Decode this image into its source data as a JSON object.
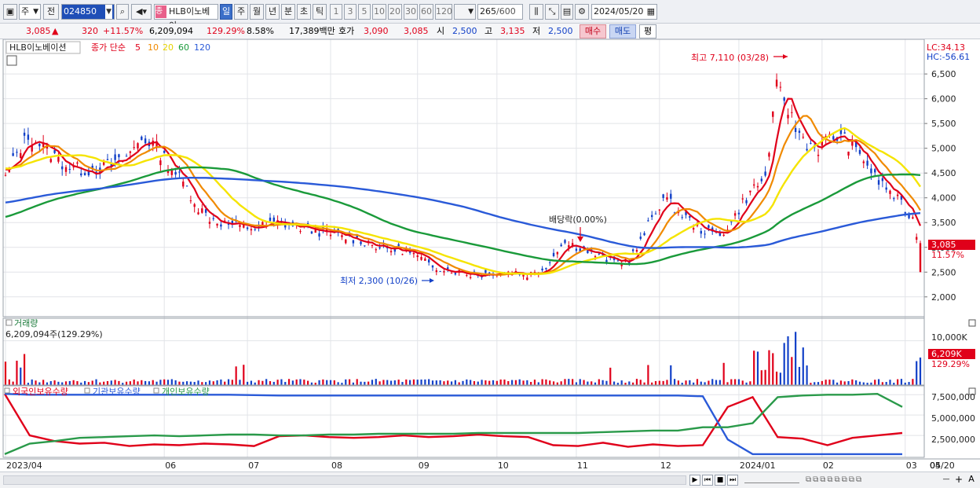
{
  "toolbar": {
    "period_type": "주",
    "prev_label": "전",
    "stock_code": "024850",
    "stock_tag": "종",
    "stock_name": "HLB이노베이",
    "intervals": [
      "일",
      "주",
      "월",
      "년",
      "분",
      "초",
      "틱"
    ],
    "active_interval": "일",
    "minute_options": [
      "1",
      "3",
      "5",
      "10",
      "20",
      "30",
      "60",
      "120"
    ],
    "count": "265",
    "count_total": "/600",
    "date": "2024/05/20"
  },
  "quote": {
    "price": "3,085",
    "change_arrow": "▲",
    "change": "320",
    "change_pct": "+11.57%",
    "volume": "6,209,094",
    "volume_ratio": "129.29%",
    "turnover_rate": "8.58%",
    "trade_value": "17,389백만",
    "ask_label": "호가",
    "ask1": "3,090",
    "ask2": "3,085",
    "open_label": "시",
    "open": "2,500",
    "high_label": "고",
    "high": "3,135",
    "low_label": "저",
    "low": "2,500",
    "buy_label": "매수",
    "sell_label": "매도",
    "flat_label": "평"
  },
  "colors": {
    "up": "#e0001a",
    "down": "#1240c8",
    "ma5": "#e0001a",
    "ma10": "#f08a00",
    "ma20": "#f5e400",
    "ma60": "#1a9a3a",
    "ma120": "#2a5ad8",
    "foreign": "#e0001a",
    "institution": "#2a5ad8",
    "individual": "#2a9a4a"
  },
  "chart_data": [
    {
      "type": "candlestick",
      "legend": {
        "title": "HLB이노베이션",
        "prefix": "종가 단순",
        "ma_periods": [
          "5",
          "10",
          "20",
          "60",
          "120"
        ]
      },
      "x_ticks": [
        "2023/04",
        "06",
        "07",
        "08",
        "09",
        "10",
        "11",
        "12",
        "2024/01",
        "02",
        "03",
        "04",
        "05",
        "05/20"
      ],
      "y_ticks": [
        "2,000",
        "2,500",
        "3,000",
        "3,500",
        "4,000",
        "4,500",
        "5,000",
        "5,500",
        "6,000",
        "6,500"
      ],
      "ylim": [
        1600,
        7200
      ],
      "lc": "LC:34.13",
      "hc": "HC:-56.61",
      "last_price_label": "3,085",
      "last_change_label": "11.57%",
      "annotations": {
        "high": "최고 7,110 (03/28)",
        "low": "최저 2,300 (10/26)",
        "dividend": "배당락(0.00%)"
      },
      "close_path": [
        [
          0,
          4400
        ],
        [
          3,
          4900
        ],
        [
          6,
          5250
        ],
        [
          9,
          5100
        ],
        [
          12,
          4900
        ],
        [
          15,
          4700
        ],
        [
          18,
          4600
        ],
        [
          21,
          4550
        ],
        [
          24,
          4600
        ],
        [
          27,
          4650
        ],
        [
          30,
          4700
        ],
        [
          33,
          4900
        ],
        [
          36,
          5200
        ],
        [
          39,
          5100
        ],
        [
          42,
          4800
        ],
        [
          45,
          4500
        ],
        [
          48,
          4200
        ],
        [
          51,
          3800
        ],
        [
          54,
          3600
        ],
        [
          57,
          3500
        ],
        [
          60,
          3450
        ],
        [
          63,
          3400
        ],
        [
          66,
          3400
        ],
        [
          69,
          3450
        ],
        [
          72,
          3500
        ],
        [
          75,
          3450
        ],
        [
          78,
          3400
        ],
        [
          81,
          3350
        ],
        [
          84,
          3300
        ],
        [
          87,
          3250
        ],
        [
          90,
          3200
        ],
        [
          93,
          3150
        ],
        [
          96,
          3100
        ],
        [
          99,
          3000
        ],
        [
          102,
          2950
        ],
        [
          105,
          2950
        ],
        [
          108,
          2850
        ],
        [
          111,
          2700
        ],
        [
          114,
          2600
        ],
        [
          117,
          2550
        ],
        [
          120,
          2500
        ],
        [
          123,
          2450
        ],
        [
          126,
          2450
        ],
        [
          129,
          2500
        ],
        [
          132,
          2500
        ],
        [
          135,
          2500
        ],
        [
          138,
          2450
        ],
        [
          141,
          2500
        ],
        [
          144,
          2700
        ],
        [
          147,
          3100
        ],
        [
          150,
          3050
        ],
        [
          153,
          2950
        ],
        [
          156,
          2850
        ],
        [
          159,
          2750
        ],
        [
          162,
          2700
        ],
        [
          165,
          2750
        ],
        [
          168,
          3100
        ],
        [
          171,
          3600
        ],
        [
          174,
          4000
        ],
        [
          177,
          3800
        ],
        [
          180,
          3600
        ],
        [
          183,
          3400
        ],
        [
          186,
          3300
        ],
        [
          189,
          3250
        ],
        [
          192,
          3500
        ],
        [
          195,
          3900
        ],
        [
          198,
          4200
        ],
        [
          201,
          4400
        ],
        [
          204,
          6200
        ],
        [
          206,
          6000
        ],
        [
          209,
          5400
        ],
        [
          212,
          5100
        ],
        [
          215,
          5000
        ],
        [
          218,
          5200
        ],
        [
          221,
          5250
        ],
        [
          224,
          5000
        ],
        [
          227,
          4800
        ],
        [
          230,
          4400
        ],
        [
          233,
          4200
        ],
        [
          236,
          3950
        ],
        [
          238,
          3750
        ],
        [
          240,
          3550
        ],
        [
          241,
          3300
        ],
        [
          242,
          3085
        ]
      ]
    },
    {
      "type": "bar",
      "legend": "거래량",
      "volume_label": "6,209,094주(129.29%)",
      "y_ticks": [
        "10,000K"
      ],
      "last_label": "6,209K",
      "last_pct": "129.29%",
      "unit": "K shares"
    },
    {
      "type": "line",
      "legend": [
        "외국인보유수량",
        "기관보유수량",
        "개인보유수량"
      ],
      "y_ticks": [
        "7,500,000",
        "5,000,000",
        "2,500,000"
      ],
      "series": [
        {
          "name": "외국인보유수량",
          "values": [
            7600000,
            2500000,
            1800000,
            1500000,
            1600000,
            1200000,
            1400000,
            1300000,
            1500000,
            1400000,
            1200000,
            2400000,
            2500000,
            2300000,
            2200000,
            2300000,
            2500000,
            2300000,
            2400000,
            2600000,
            2400000,
            2300000,
            1300000,
            1200000,
            1600000,
            1100000,
            1400000,
            1200000,
            1300000,
            6000000,
            7200000,
            2300000,
            2100000,
            1300000,
            2200000,
            2500000,
            2800000
          ]
        },
        {
          "name": "기관보유수량",
          "values": [
            7600000,
            7500000,
            7500000,
            7500000,
            7500000,
            7500000,
            7500000,
            7500000,
            7500000,
            7500000,
            7450000,
            7400000,
            7400000,
            7400000,
            7400000,
            7400000,
            7400000,
            7400000,
            7400000,
            7400000,
            7400000,
            7400000,
            7400000,
            7400000,
            7400000,
            7400000,
            7400000,
            7400000,
            7300000,
            2000000,
            200000,
            200000,
            200000,
            200000,
            200000,
            200000,
            200000
          ]
        },
        {
          "name": "개인보유수량",
          "values": [
            200000,
            1500000,
            1800000,
            2200000,
            2300000,
            2400000,
            2500000,
            2400000,
            2500000,
            2600000,
            2600000,
            2500000,
            2500000,
            2600000,
            2600000,
            2700000,
            2700000,
            2700000,
            2700000,
            2800000,
            2800000,
            2800000,
            2800000,
            2800000,
            2900000,
            3000000,
            3100000,
            3100000,
            3500000,
            3500000,
            4000000,
            7200000,
            7400000,
            7500000,
            7500000,
            7600000,
            6000000
          ]
        }
      ]
    }
  ],
  "bottom": {
    "nav_icons": [
      "play-icon",
      "first-icon",
      "stop-icon",
      "last-icon"
    ],
    "tool_icons": [
      "minus-icon",
      "plus-icon",
      "a-icon"
    ]
  }
}
